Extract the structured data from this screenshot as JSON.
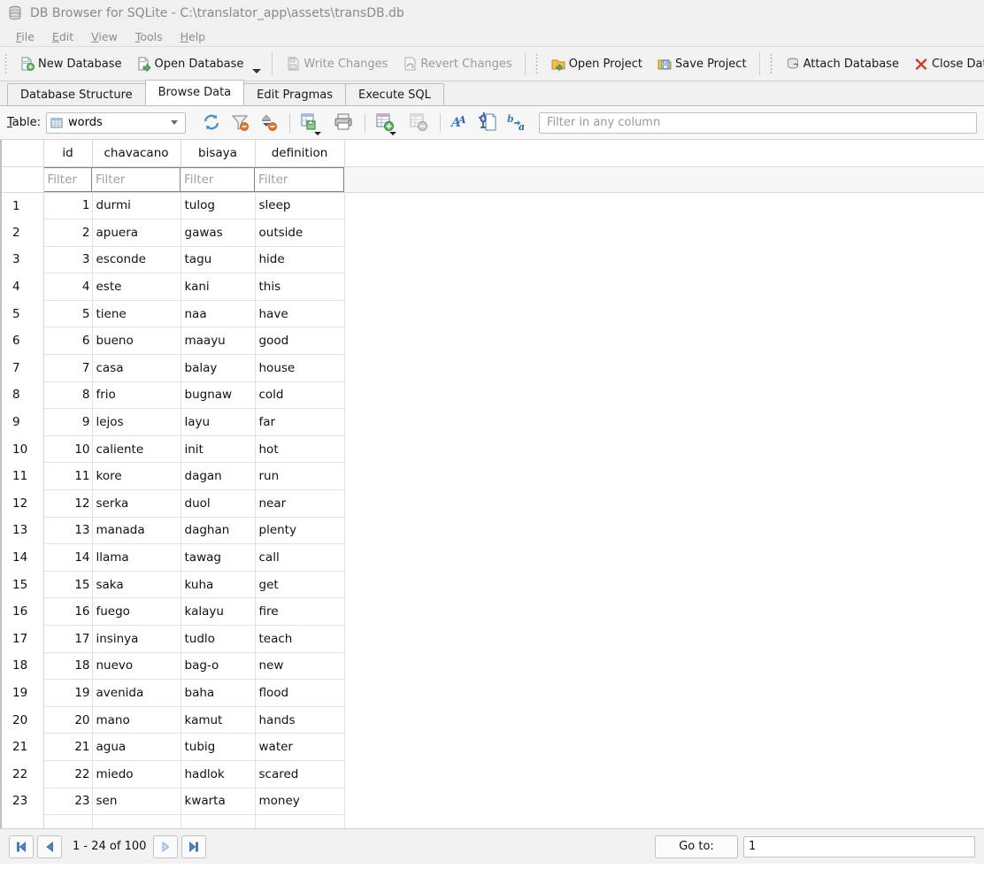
{
  "window": {
    "title": "DB Browser for SQLite - C:\\translator_app\\assets\\transDB.db",
    "app_icon": "database-icon"
  },
  "menubar": {
    "items": [
      {
        "label": "File",
        "mnemonic": "F"
      },
      {
        "label": "Edit",
        "mnemonic": "E"
      },
      {
        "label": "View",
        "mnemonic": "V"
      },
      {
        "label": "Tools",
        "mnemonic": "T"
      },
      {
        "label": "Help",
        "mnemonic": "H"
      }
    ]
  },
  "toolbar": {
    "buttons": [
      {
        "label": "New Database",
        "icon": "new-database-icon",
        "enabled": true
      },
      {
        "label": "Open Database",
        "icon": "open-database-icon",
        "enabled": true,
        "has_dropdown": true
      },
      {
        "label": "Write Changes",
        "icon": "write-changes-icon",
        "enabled": false
      },
      {
        "label": "Revert Changes",
        "icon": "revert-changes-icon",
        "enabled": false
      },
      {
        "label": "Open Project",
        "icon": "open-project-icon",
        "enabled": true
      },
      {
        "label": "Save Project",
        "icon": "save-project-icon",
        "enabled": true
      },
      {
        "label": "Attach Database",
        "icon": "attach-database-icon",
        "enabled": true
      },
      {
        "label": "Close Database",
        "icon": "close-database-icon",
        "enabled": true
      }
    ]
  },
  "tabs": {
    "items": [
      {
        "label": "Database Structure",
        "active": false
      },
      {
        "label": "Browse Data",
        "active": true
      },
      {
        "label": "Edit Pragmas",
        "active": false
      },
      {
        "label": "Execute SQL",
        "active": false
      }
    ]
  },
  "table_toolbar": {
    "table_label": "Table:",
    "table_label_mnemonic": "T",
    "selected_table": "words",
    "icons": [
      {
        "name": "refresh-icon"
      },
      {
        "name": "clear-filters-icon"
      },
      {
        "name": "clear-sorting-icon"
      },
      {
        "name": "save-results-icon"
      },
      {
        "name": "print-icon"
      },
      {
        "name": "insert-record-icon"
      },
      {
        "name": "delete-record-icon"
      },
      {
        "name": "modify-conditional-format-icon"
      },
      {
        "name": "find-in-cell-icon"
      },
      {
        "name": "replace-icon"
      }
    ],
    "filter_placeholder": "Filter in any column"
  },
  "grid": {
    "columns": [
      "id",
      "chavacano",
      "bisaya",
      "definition"
    ],
    "filter_placeholder": "Filter",
    "rows": [
      {
        "n": "1",
        "id": "1",
        "chavacano": "durmi",
        "bisaya": "tulog",
        "definition": "sleep"
      },
      {
        "n": "2",
        "id": "2",
        "chavacano": "apuera",
        "bisaya": "gawas",
        "definition": "outside"
      },
      {
        "n": "3",
        "id": "3",
        "chavacano": "esconde",
        "bisaya": "tagu",
        "definition": "hide"
      },
      {
        "n": "4",
        "id": "4",
        "chavacano": "este",
        "bisaya": "kani",
        "definition": "this"
      },
      {
        "n": "5",
        "id": "5",
        "chavacano": "tiene",
        "bisaya": "naa",
        "definition": "have"
      },
      {
        "n": "6",
        "id": "6",
        "chavacano": "bueno",
        "bisaya": "maayu",
        "definition": "good"
      },
      {
        "n": "7",
        "id": "7",
        "chavacano": "casa",
        "bisaya": "balay",
        "definition": "house"
      },
      {
        "n": "8",
        "id": "8",
        "chavacano": "frio",
        "bisaya": "bugnaw",
        "definition": "cold"
      },
      {
        "n": "9",
        "id": "9",
        "chavacano": "lejos",
        "bisaya": "layu",
        "definition": "far"
      },
      {
        "n": "10",
        "id": "10",
        "chavacano": "caliente",
        "bisaya": "init",
        "definition": "hot"
      },
      {
        "n": "11",
        "id": "11",
        "chavacano": "kore",
        "bisaya": "dagan",
        "definition": "run"
      },
      {
        "n": "12",
        "id": "12",
        "chavacano": "serka",
        "bisaya": "duol",
        "definition": "near"
      },
      {
        "n": "13",
        "id": "13",
        "chavacano": "manada",
        "bisaya": "daghan",
        "definition": "plenty"
      },
      {
        "n": "14",
        "id": "14",
        "chavacano": "llama",
        "bisaya": "tawag",
        "definition": "call"
      },
      {
        "n": "15",
        "id": "15",
        "chavacano": "saka",
        "bisaya": "kuha",
        "definition": "get"
      },
      {
        "n": "16",
        "id": "16",
        "chavacano": "fuego",
        "bisaya": "kalayu",
        "definition": "fire"
      },
      {
        "n": "17",
        "id": "17",
        "chavacano": "insinya",
        "bisaya": "tudlo",
        "definition": "teach"
      },
      {
        "n": "18",
        "id": "18",
        "chavacano": "nuevo",
        "bisaya": "bag-o",
        "definition": "new"
      },
      {
        "n": "19",
        "id": "19",
        "chavacano": "avenida",
        "bisaya": "baha",
        "definition": "flood"
      },
      {
        "n": "20",
        "id": "20",
        "chavacano": "mano",
        "bisaya": "kamut",
        "definition": "hands"
      },
      {
        "n": "21",
        "id": "21",
        "chavacano": "agua",
        "bisaya": "tubig",
        "definition": "water"
      },
      {
        "n": "22",
        "id": "22",
        "chavacano": "miedo",
        "bisaya": "hadlok",
        "definition": "scared"
      },
      {
        "n": "23",
        "id": "23",
        "chavacano": "sen",
        "bisaya": "kwarta",
        "definition": "money"
      },
      {
        "n": "",
        "id": "",
        "chavacano": "",
        "bisaya": "",
        "definition": ""
      }
    ]
  },
  "statusbar": {
    "first_page_label": "first-page",
    "prev_page_label": "previous-page",
    "next_page_label": "next-page",
    "last_page_label": "last-page",
    "range": "1 - 24 of 100",
    "goto_label": "Go to:",
    "goto_value": "1"
  },
  "colors": {
    "chrome": "#f0f0f0",
    "toolbar": "#f2f2f2",
    "grid_line": "#e2e2e2",
    "header_line": "#d8d8d8",
    "accent_blue": "#3a6ea5",
    "close_red": "#d4302a",
    "title_text": "#8a8a8a"
  }
}
